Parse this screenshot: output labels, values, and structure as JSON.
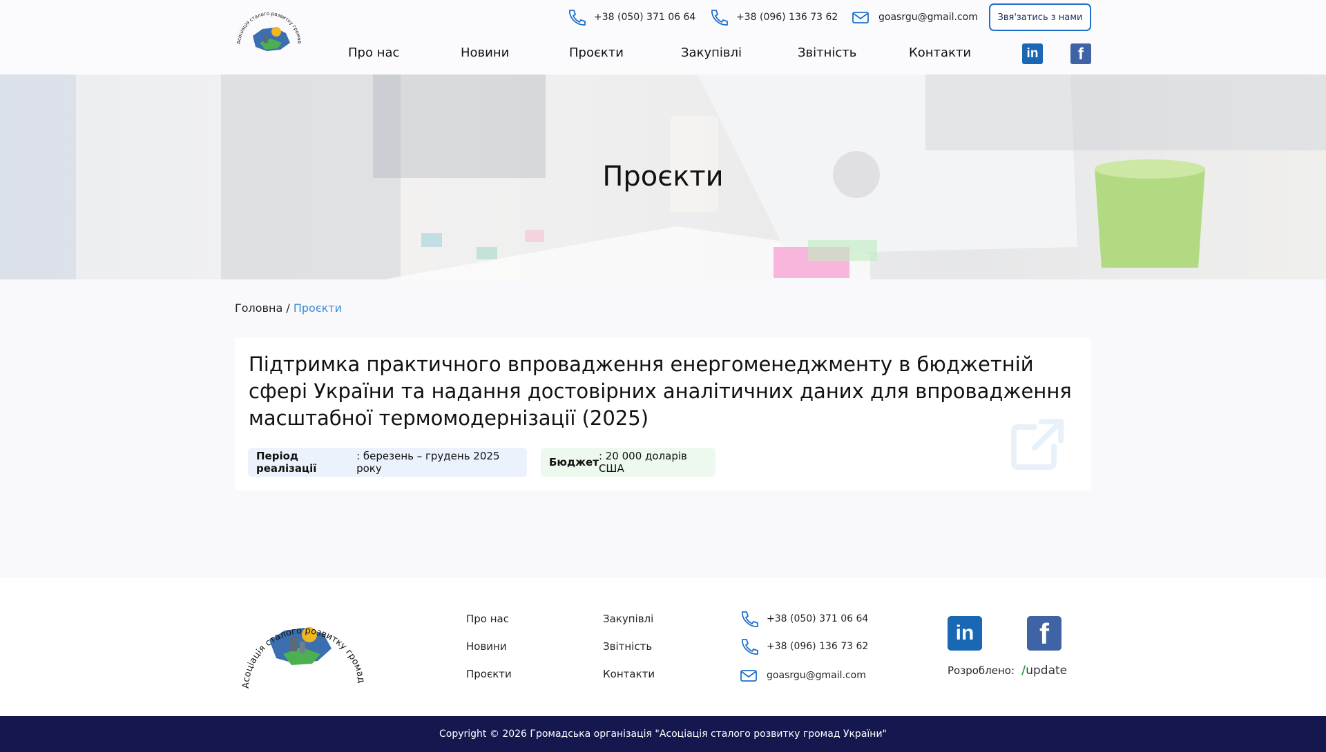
{
  "header": {
    "phone1": "+38 (050) 371 06 64",
    "phone2": "+38 (096) 136 73 62",
    "email": "goasrgu@gmail.com",
    "cta": "Звя'затись з нами",
    "logo_text": "Асоціація сталого розвитку громад України",
    "nav": [
      "Про нас",
      "Новини",
      "Проєкти",
      "Закупівлі",
      "Звітність",
      "Контакти"
    ],
    "social": {
      "linkedin": "in",
      "facebook": "f"
    }
  },
  "hero": {
    "title": "Проєкти"
  },
  "breadcrumb": {
    "home": "Головна",
    "separator": "/",
    "current": "Проєкти"
  },
  "project": {
    "title": "Підтримка практичного впровадження енергоменеджменту в бюджетній сфері України та надання достовірних аналітичних даних для впровадження масштабної термомодернізації (2025)",
    "period_label": "Період реалізації",
    "period_value": ": березень – грудень 2025 року",
    "budget_label": "Бюджет",
    "budget_value": ": 20 000 доларів США"
  },
  "footer": {
    "links_col1": [
      "Про нас",
      "Новини",
      "Проєкти"
    ],
    "links_col2": [
      "Закупівлі",
      "Звітність",
      "Контакти"
    ],
    "phone1": "+38 (050) 371 06 64",
    "phone2": "+38 (096) 136 73 62",
    "email": "goasrgu@gmail.com",
    "made_by_label": "Розроблено:",
    "made_by_brand": "update",
    "copyright": "Copyright © 2026 Громадська організація \"Асоціація сталого розвитку громад України\""
  },
  "colors": {
    "accent": "#1d6fc9",
    "breadcrumb_active": "#3a8ad4",
    "linkedin": "#1a67b3",
    "facebook": "#3f63a4",
    "copyright_bg": "#14184f"
  },
  "icons": [
    "phone-icon",
    "mail-icon",
    "linkedin-icon",
    "facebook-icon",
    "external-link-icon"
  ]
}
